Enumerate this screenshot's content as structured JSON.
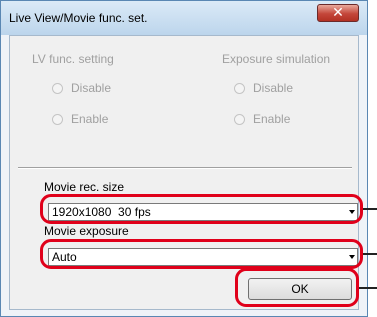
{
  "window": {
    "title": "Live View/Movie func. set.",
    "close_icon": "close-icon"
  },
  "lv_func": {
    "label": "LV func. setting",
    "options": [
      "Disable",
      "Enable"
    ]
  },
  "exposure_sim": {
    "label": "Exposure simulation",
    "options": [
      "Disable",
      "Enable"
    ]
  },
  "movie_rec_size": {
    "label": "Movie rec. size",
    "value": "1920x1080  30 fps"
  },
  "movie_exposure": {
    "label": "Movie exposure",
    "value": "Auto"
  },
  "ok_button": {
    "label": "OK"
  },
  "colors": {
    "highlight": "#e0001a",
    "title_bar": "#c9def0",
    "disabled_text": "#a0a0a0"
  }
}
